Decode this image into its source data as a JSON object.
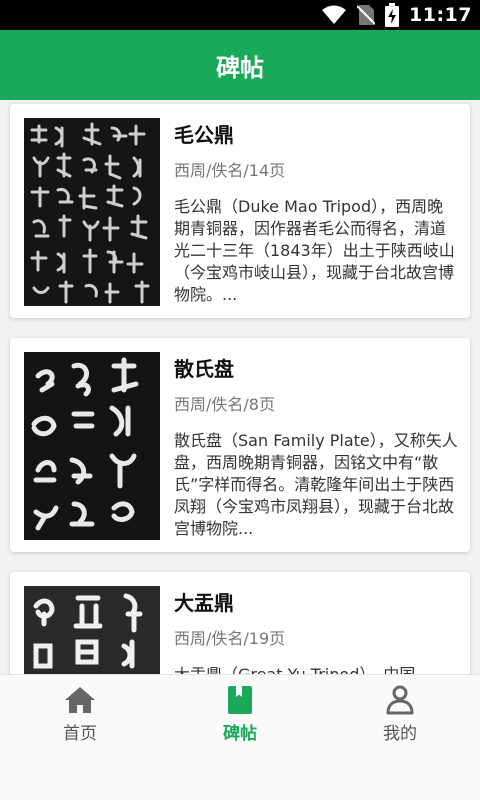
{
  "status_bar": {
    "time": "11:17",
    "icons": [
      "wifi-icon",
      "no-sim-icon",
      "battery-charging-icon"
    ]
  },
  "app_bar": {
    "title": "碑帖"
  },
  "items": [
    {
      "title": "毛公鼎",
      "meta": "西周/佚名/14页",
      "desc": "毛公鼎（Duke Mao Tripod），西周晚期青铜器，因作器者毛公而得名，清道光二十三年（1843年）出土于陕西岐山（今宝鸡市岐山县），现藏于台北故宫博物院。..."
    },
    {
      "title": "散氏盘",
      "meta": "西周/佚名/8页",
      "desc": "散氏盘（San Family Plate），又称矢人盘，西周晚期青铜器，因铭文中有“散氏”字样而得名。清乾隆年间出土于陕西凤翔（今宝鸡市凤翔县），现藏于台北故宫博物院..."
    },
    {
      "title": "大盂鼎",
      "meta": "西周/佚名/19页",
      "desc": "大盂鼎（Great Yu Tripod），中国"
    }
  ],
  "bottom_nav": [
    {
      "label": "首页",
      "icon": "home-icon",
      "active": false
    },
    {
      "label": "碑帖",
      "icon": "book-icon",
      "active": true
    },
    {
      "label": "我的",
      "icon": "user-icon",
      "active": false
    }
  ],
  "colors": {
    "primary": "#1aa85a",
    "nav_inactive": "#555555"
  }
}
